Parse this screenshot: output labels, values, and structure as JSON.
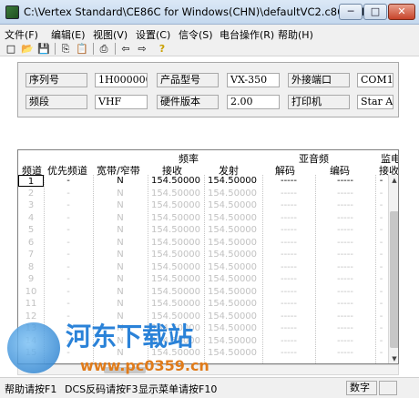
{
  "window": {
    "title": "C:\\Vertex Standard\\CE86C for Windows(CHN)\\defaultVC2.c86 - CE8...",
    "controls": {
      "minimize": "─",
      "maximize": "□",
      "close": "✕"
    }
  },
  "menu": [
    "文件(F)",
    "编辑(E)",
    "视图(V)",
    "设置(C)",
    "信令(S)",
    "电台操作(R)",
    "帮助(H)"
  ],
  "toolbar": {
    "icons": [
      "new-file-icon",
      "open-folder-icon",
      "save-icon",
      "copy-icon",
      "paste-icon",
      "print-icon",
      "read-radio-icon",
      "write-radio-icon",
      "help-icon"
    ],
    "glyphs": [
      "□",
      "📂",
      "💾",
      "⎘",
      "📋",
      "⎙",
      "⇦",
      "⇨",
      "?"
    ]
  },
  "info": {
    "serial_label": "序列号",
    "serial_value": "1H000000",
    "model_label": "产品型号",
    "model_value": "VX-350",
    "port_label": "外接端口",
    "port_value": "COM1",
    "band_label": "频段",
    "band_value": "VHF",
    "hw_label": "硬件版本",
    "hw_value": "2.00",
    "printer_label": "打印机",
    "printer_value": "Star A"
  },
  "table": {
    "group_headers": {
      "freq": "频率",
      "subtone": "亚音频",
      "ptt": "监电"
    },
    "columns": [
      "频道",
      "优先频道",
      "宽带/窄带",
      "接收",
      "发射",
      "解码",
      "编码",
      "接收"
    ],
    "rows": [
      [
        "1",
        "-",
        "N",
        "154.50000",
        "154.50000",
        "-----",
        "-----",
        "-"
      ],
      [
        "2",
        "-",
        "N",
        "154.50000",
        "154.50000",
        "-----",
        "-----",
        "-"
      ],
      [
        "3",
        "-",
        "N",
        "154.50000",
        "154.50000",
        "-----",
        "-----",
        "-"
      ],
      [
        "4",
        "-",
        "N",
        "154.50000",
        "154.50000",
        "-----",
        "-----",
        "-"
      ],
      [
        "5",
        "-",
        "N",
        "154.50000",
        "154.50000",
        "-----",
        "-----",
        "-"
      ],
      [
        "6",
        "-",
        "N",
        "154.50000",
        "154.50000",
        "-----",
        "-----",
        "-"
      ],
      [
        "7",
        "-",
        "N",
        "154.50000",
        "154.50000",
        "-----",
        "-----",
        "-"
      ],
      [
        "8",
        "-",
        "N",
        "154.50000",
        "154.50000",
        "-----",
        "-----",
        "-"
      ],
      [
        "9",
        "-",
        "N",
        "154.50000",
        "154.50000",
        "-----",
        "-----",
        "-"
      ],
      [
        "10",
        "-",
        "N",
        "154.50000",
        "154.50000",
        "-----",
        "-----",
        "-"
      ],
      [
        "11",
        "-",
        "N",
        "154.50000",
        "154.50000",
        "-----",
        "-----",
        "-"
      ],
      [
        "12",
        "-",
        "N",
        "154.50000",
        "154.50000",
        "-----",
        "-----",
        "-"
      ],
      [
        "13",
        "-",
        "N",
        "154.50000",
        "154.50000",
        "-----",
        "-----",
        "-"
      ],
      [
        "14",
        "-",
        "N",
        "154.50000",
        "154.50000",
        "-----",
        "-----",
        "-"
      ],
      [
        "15",
        "-",
        "N",
        "154.50000",
        "154.50000",
        "-----",
        "-----",
        "-"
      ]
    ],
    "row_colors": {
      "active": "#000000",
      "inactive": "#c2c2c2"
    }
  },
  "status": {
    "help": "帮助请按F1",
    "dcs": "DCS反码请按F3",
    "menu": "显示菜单请按F10",
    "num": "数字"
  },
  "watermark": {
    "title": "河东下载站",
    "url": "www.pc0359.cn"
  }
}
